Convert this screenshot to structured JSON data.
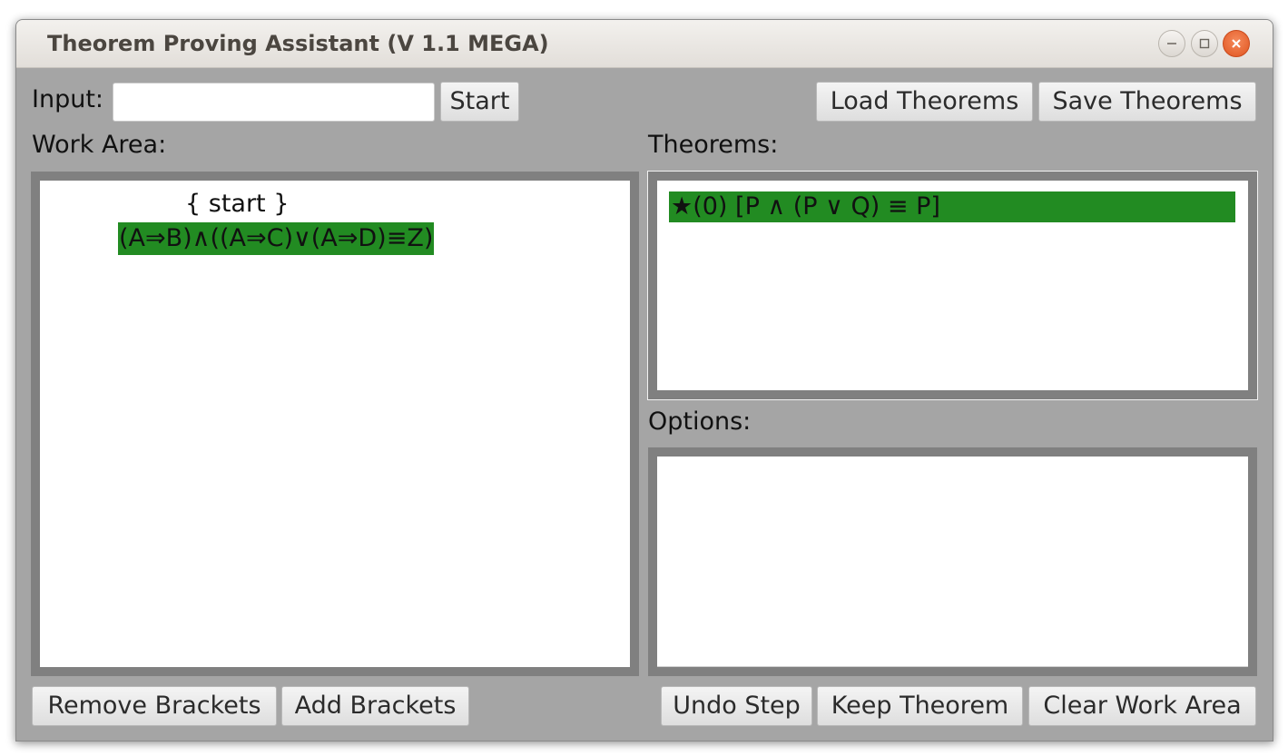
{
  "window": {
    "title": "Theorem Proving Assistant (V 1.1 MEGA)",
    "controls": [
      "minimize-icon",
      "maximize-icon",
      "close-icon"
    ]
  },
  "toolbar": {
    "input_label": "Input:",
    "input_value": "",
    "start_label": "Start",
    "load_label": "Load Theorems",
    "save_label": "Save Theorems"
  },
  "work_area": {
    "label": "Work Area:",
    "start_text": "{ start }",
    "formula": "(A⇒B)∧((A⇒C)∨(A⇒D)≡Z)"
  },
  "theorems": {
    "label": "Theorems:",
    "items": [
      "★(0) [P ∧ (P ∨ Q) ≡ P]"
    ]
  },
  "options": {
    "label": "Options:",
    "items": []
  },
  "bottom_bar": {
    "remove_brackets_label": "Remove Brackets",
    "add_brackets_label": "Add Brackets",
    "undo_label": "Undo Step",
    "keep_label": "Keep Theorem",
    "clear_label": "Clear Work Area"
  },
  "colors": {
    "background": "#a5a5a5",
    "panel_border": "#808080",
    "highlight": "#228b22",
    "close_button": "#e0541f"
  }
}
